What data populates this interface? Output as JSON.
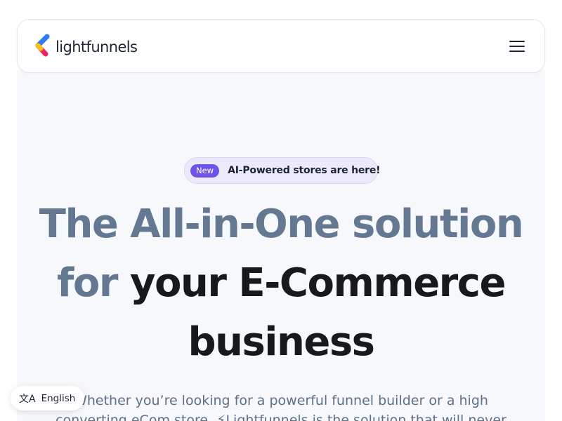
{
  "brand": {
    "name": "lightfunnels"
  },
  "nav": {
    "menu_icon": "hamburger-menu-icon"
  },
  "announcement": {
    "badge": "New",
    "text": "AI-Powered stores are here!"
  },
  "hero": {
    "headline_muted_1": "The All-in-One solution",
    "headline_muted_2": "for",
    "headline_dark_1": "your E-Commerce",
    "headline_dark_2": "business",
    "subtext": "Whether you’re looking for a powerful funnel builder or a high converting eCom store, ⚡Lightfunnels is the solution that will never"
  },
  "language": {
    "icon": "translate-icon",
    "icon_glyph": "文A",
    "label": "English"
  },
  "colors": {
    "accent_purple": "#6f52e9",
    "headline_muted": "#647891",
    "headline_dark": "#17191f",
    "logo_blue": "#2f7bf5",
    "logo_pink": "#f0245c",
    "logo_yellow": "#f7c21b"
  }
}
